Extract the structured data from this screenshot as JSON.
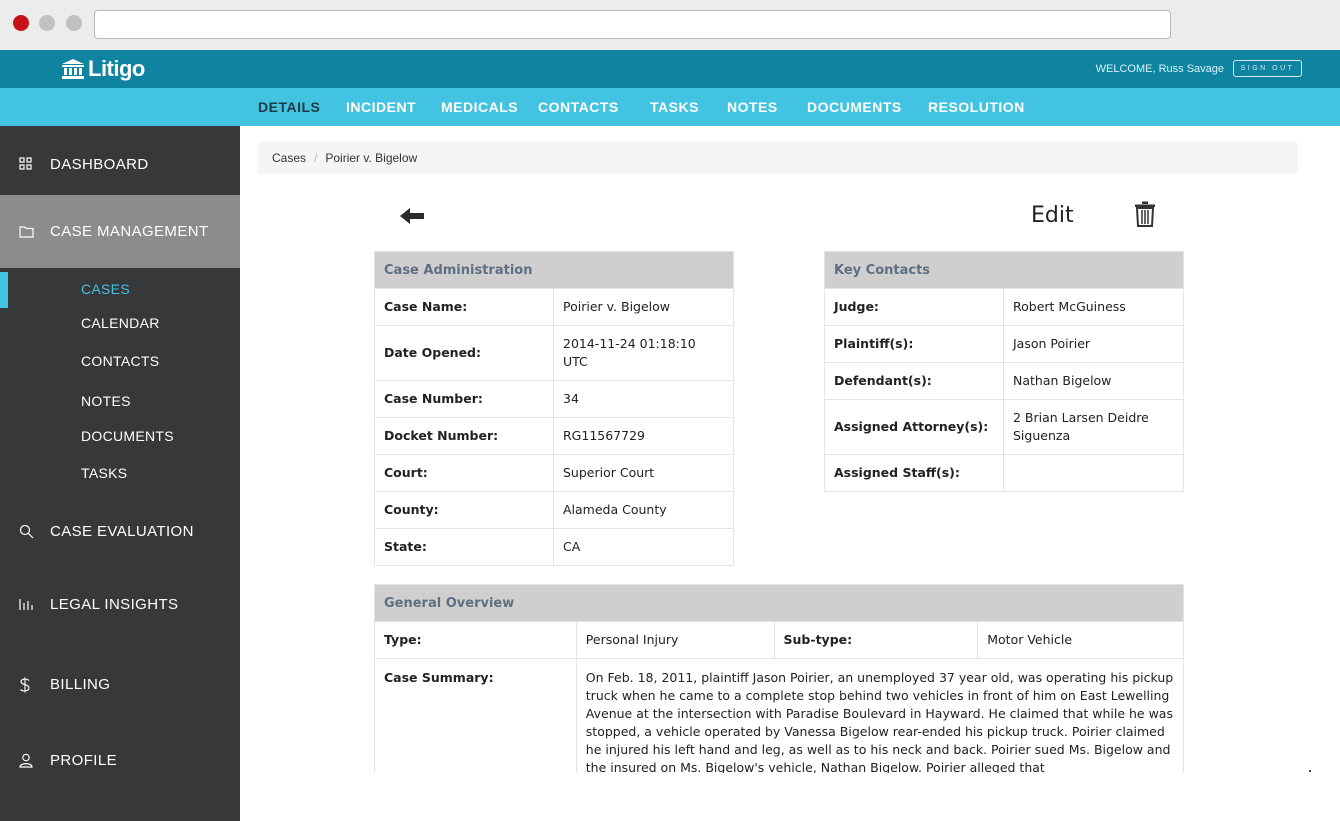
{
  "app": {
    "name": "Litigo"
  },
  "header": {
    "welcome": "WELCOME, Russ Savage",
    "sign_out": "SIGN OUT"
  },
  "nav": {
    "tabs": [
      {
        "label": "DETAILS",
        "active": true
      },
      {
        "label": "INCIDENT"
      },
      {
        "label": "MEDICALS"
      },
      {
        "label": "CONTACTS"
      },
      {
        "label": "TASKS"
      },
      {
        "label": "NOTES"
      },
      {
        "label": "DOCUMENTS"
      },
      {
        "label": "RESOLUTION"
      }
    ]
  },
  "sidebar": {
    "items": [
      {
        "label": "DASHBOARD",
        "icon": "grid-icon"
      },
      {
        "label": "CASE MANAGEMENT",
        "icon": "folder-icon",
        "active": true
      },
      {
        "label": "CASE EVALUATION",
        "icon": "search-icon"
      },
      {
        "label": "LEGAL INSIGHTS",
        "icon": "bar-chart-icon"
      },
      {
        "label": "BILLING",
        "icon": "dollar-icon"
      },
      {
        "label": "PROFILE",
        "icon": "user-icon"
      }
    ],
    "subitems": [
      {
        "label": "CASES",
        "active": true
      },
      {
        "label": "CALENDAR"
      },
      {
        "label": "CONTACTS"
      },
      {
        "label": "NOTES"
      },
      {
        "label": "DOCUMENTS"
      },
      {
        "label": "TASKS"
      }
    ]
  },
  "breadcrumb": {
    "root": "Cases",
    "current": "Poirier v. Bigelow"
  },
  "actions": {
    "edit": "Edit"
  },
  "case_admin": {
    "title": "Case Administration",
    "rows": [
      {
        "label": "Case Name:",
        "value": "Poirier v. Bigelow"
      },
      {
        "label": "Date Opened:",
        "value": "2014-11-24 01:18:10 UTC"
      },
      {
        "label": "Case Number:",
        "value": "34"
      },
      {
        "label": "Docket Number:",
        "value": "RG11567729"
      },
      {
        "label": "Court:",
        "value": "Superior Court"
      },
      {
        "label": "County:",
        "value": "Alameda County"
      },
      {
        "label": "State:",
        "value": "CA"
      }
    ]
  },
  "key_contacts": {
    "title": "Key Contacts",
    "rows": [
      {
        "label": "Judge:",
        "value": "Robert McGuiness"
      },
      {
        "label": "Plaintiff(s):",
        "value": "Jason Poirier"
      },
      {
        "label": "Defendant(s):",
        "value": "Nathan Bigelow"
      },
      {
        "label": "Assigned Attorney(s):",
        "value": "2 Brian Larsen Deidre Siguenza"
      },
      {
        "label": "Assigned Staff(s):",
        "value": ""
      }
    ]
  },
  "overview": {
    "title": "General Overview",
    "type_label": "Type:",
    "type_value": "Personal Injury",
    "subtype_label": "Sub-type:",
    "subtype_value": "Motor Vehicle",
    "summary_label": "Case Summary:",
    "summary": "On Feb. 18, 2011, plaintiff Jason Poirier, an unemployed 37 year old, was operating his pickup truck when he came to a complete stop behind two vehicles in front of him on East Lewelling Avenue at the intersection with Paradise Boulevard in Hayward. He claimed that while he was stopped, a vehicle operated by Vanessa Bigelow rear-ended his pickup truck. Poirier claimed he injured his left hand and leg, as well as to his neck and back. Poirier sued Ms. Bigelow and the insured on Ms. Bigelow's vehicle, Nathan Bigelow. Poirier alleged that"
  }
}
